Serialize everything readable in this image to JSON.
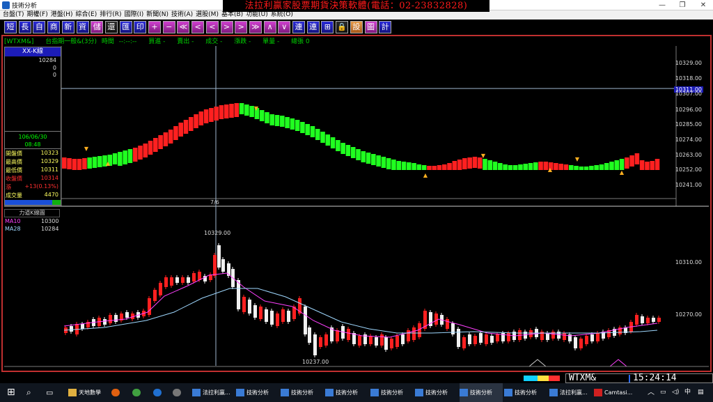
{
  "window": {
    "title": "技術分析",
    "banner": "法拉利贏家股票期貨決策軟體(電話：02-23832828)"
  },
  "menu": [
    "台盤(T)",
    "期權(F)",
    "港盤(H)",
    "綜合(E)",
    "排行(R)",
    "國際(I)",
    "新聞(N)",
    "技術(A)",
    "選股(M)",
    "基本(B)",
    "功能(U)",
    "系統(O)"
  ],
  "toolbar": [
    "短",
    "長",
    "自",
    "商",
    "新",
    "資",
    "儲",
    "還",
    "匯",
    "印",
    "+",
    "−",
    "≪",
    "<",
    "<",
    ">",
    ">",
    "≫",
    "∧",
    "∨",
    "連",
    "連",
    "⊞",
    "🔒",
    "設",
    "圖",
    "計"
  ],
  "statusline": {
    "symbol": "[WTXM&]",
    "name": "台指期一般&(3分)",
    "time_label": "時間",
    "time_val": "--:--:--",
    "bid": "買進 -",
    "ask": "賣出 -",
    "deal": "成交 -",
    "change": "漲跌 -",
    "vol": "單量 -",
    "total": "總張 0"
  },
  "left_panel": {
    "header": "XX-K線",
    "vals": [
      "10284",
      "0",
      "0"
    ],
    "date": "106/06/30",
    "time": "08:48",
    "rows": [
      {
        "k": "開盤價",
        "v": "10323",
        "kc": "#ffff60",
        "vc": "#ffff60"
      },
      {
        "k": "最高價",
        "v": "10329",
        "kc": "#ffff60",
        "vc": "#ffff60"
      },
      {
        "k": "最低價",
        "v": "10311",
        "kc": "#ffff60",
        "vc": "#ffff60"
      },
      {
        "k": "收盤價",
        "v": "10314",
        "kc": "#ff3030",
        "vc": "#ff3030"
      },
      {
        "k": "漲",
        "v": "+13(0.13%)",
        "kc": "#ff3030",
        "vc": "#ff3030"
      },
      {
        "k": "成交量",
        "v": "4470",
        "kc": "#ffff60",
        "vc": "#ffff60"
      }
    ]
  },
  "upper_axis": [
    "10329.00",
    "10318.00",
    "10311.00",
    "10307.00",
    "10296.00",
    "10285.00",
    "10274.00",
    "10263.00",
    "10252.00",
    "10241.00"
  ],
  "upper_highlight": "10311.00",
  "mid_label": "7/6",
  "lower": {
    "header": "力道K線圖",
    "ma": [
      {
        "name": "MA10",
        "value": "10300",
        "color": "#ff40ff"
      },
      {
        "name": "MA28",
        "value": "10284",
        "color": "#9fd8ff"
      }
    ],
    "axis": [
      "10310.00",
      "10270.00"
    ],
    "high_annot": "10329.00",
    "low_annot": "10237.00"
  },
  "ticker": {
    "symbol": "WTXM&",
    "time": "15:24:14"
  },
  "taskbar": [
    {
      "label": "天地數學",
      "active": false
    },
    {
      "label": "法拉利贏...",
      "active": false
    },
    {
      "label": "技術分析",
      "active": false
    },
    {
      "label": "技術分析",
      "active": false
    },
    {
      "label": "技術分析",
      "active": false
    },
    {
      "label": "技術分析",
      "active": false
    },
    {
      "label": "技術分析",
      "active": false
    },
    {
      "label": "技術分析",
      "active": true
    },
    {
      "label": "技術分析",
      "active": false
    },
    {
      "label": "法拉利贏...",
      "active": false
    },
    {
      "label": "Camtasi...",
      "active": false
    }
  ],
  "tray": {
    "lang": "中"
  }
}
